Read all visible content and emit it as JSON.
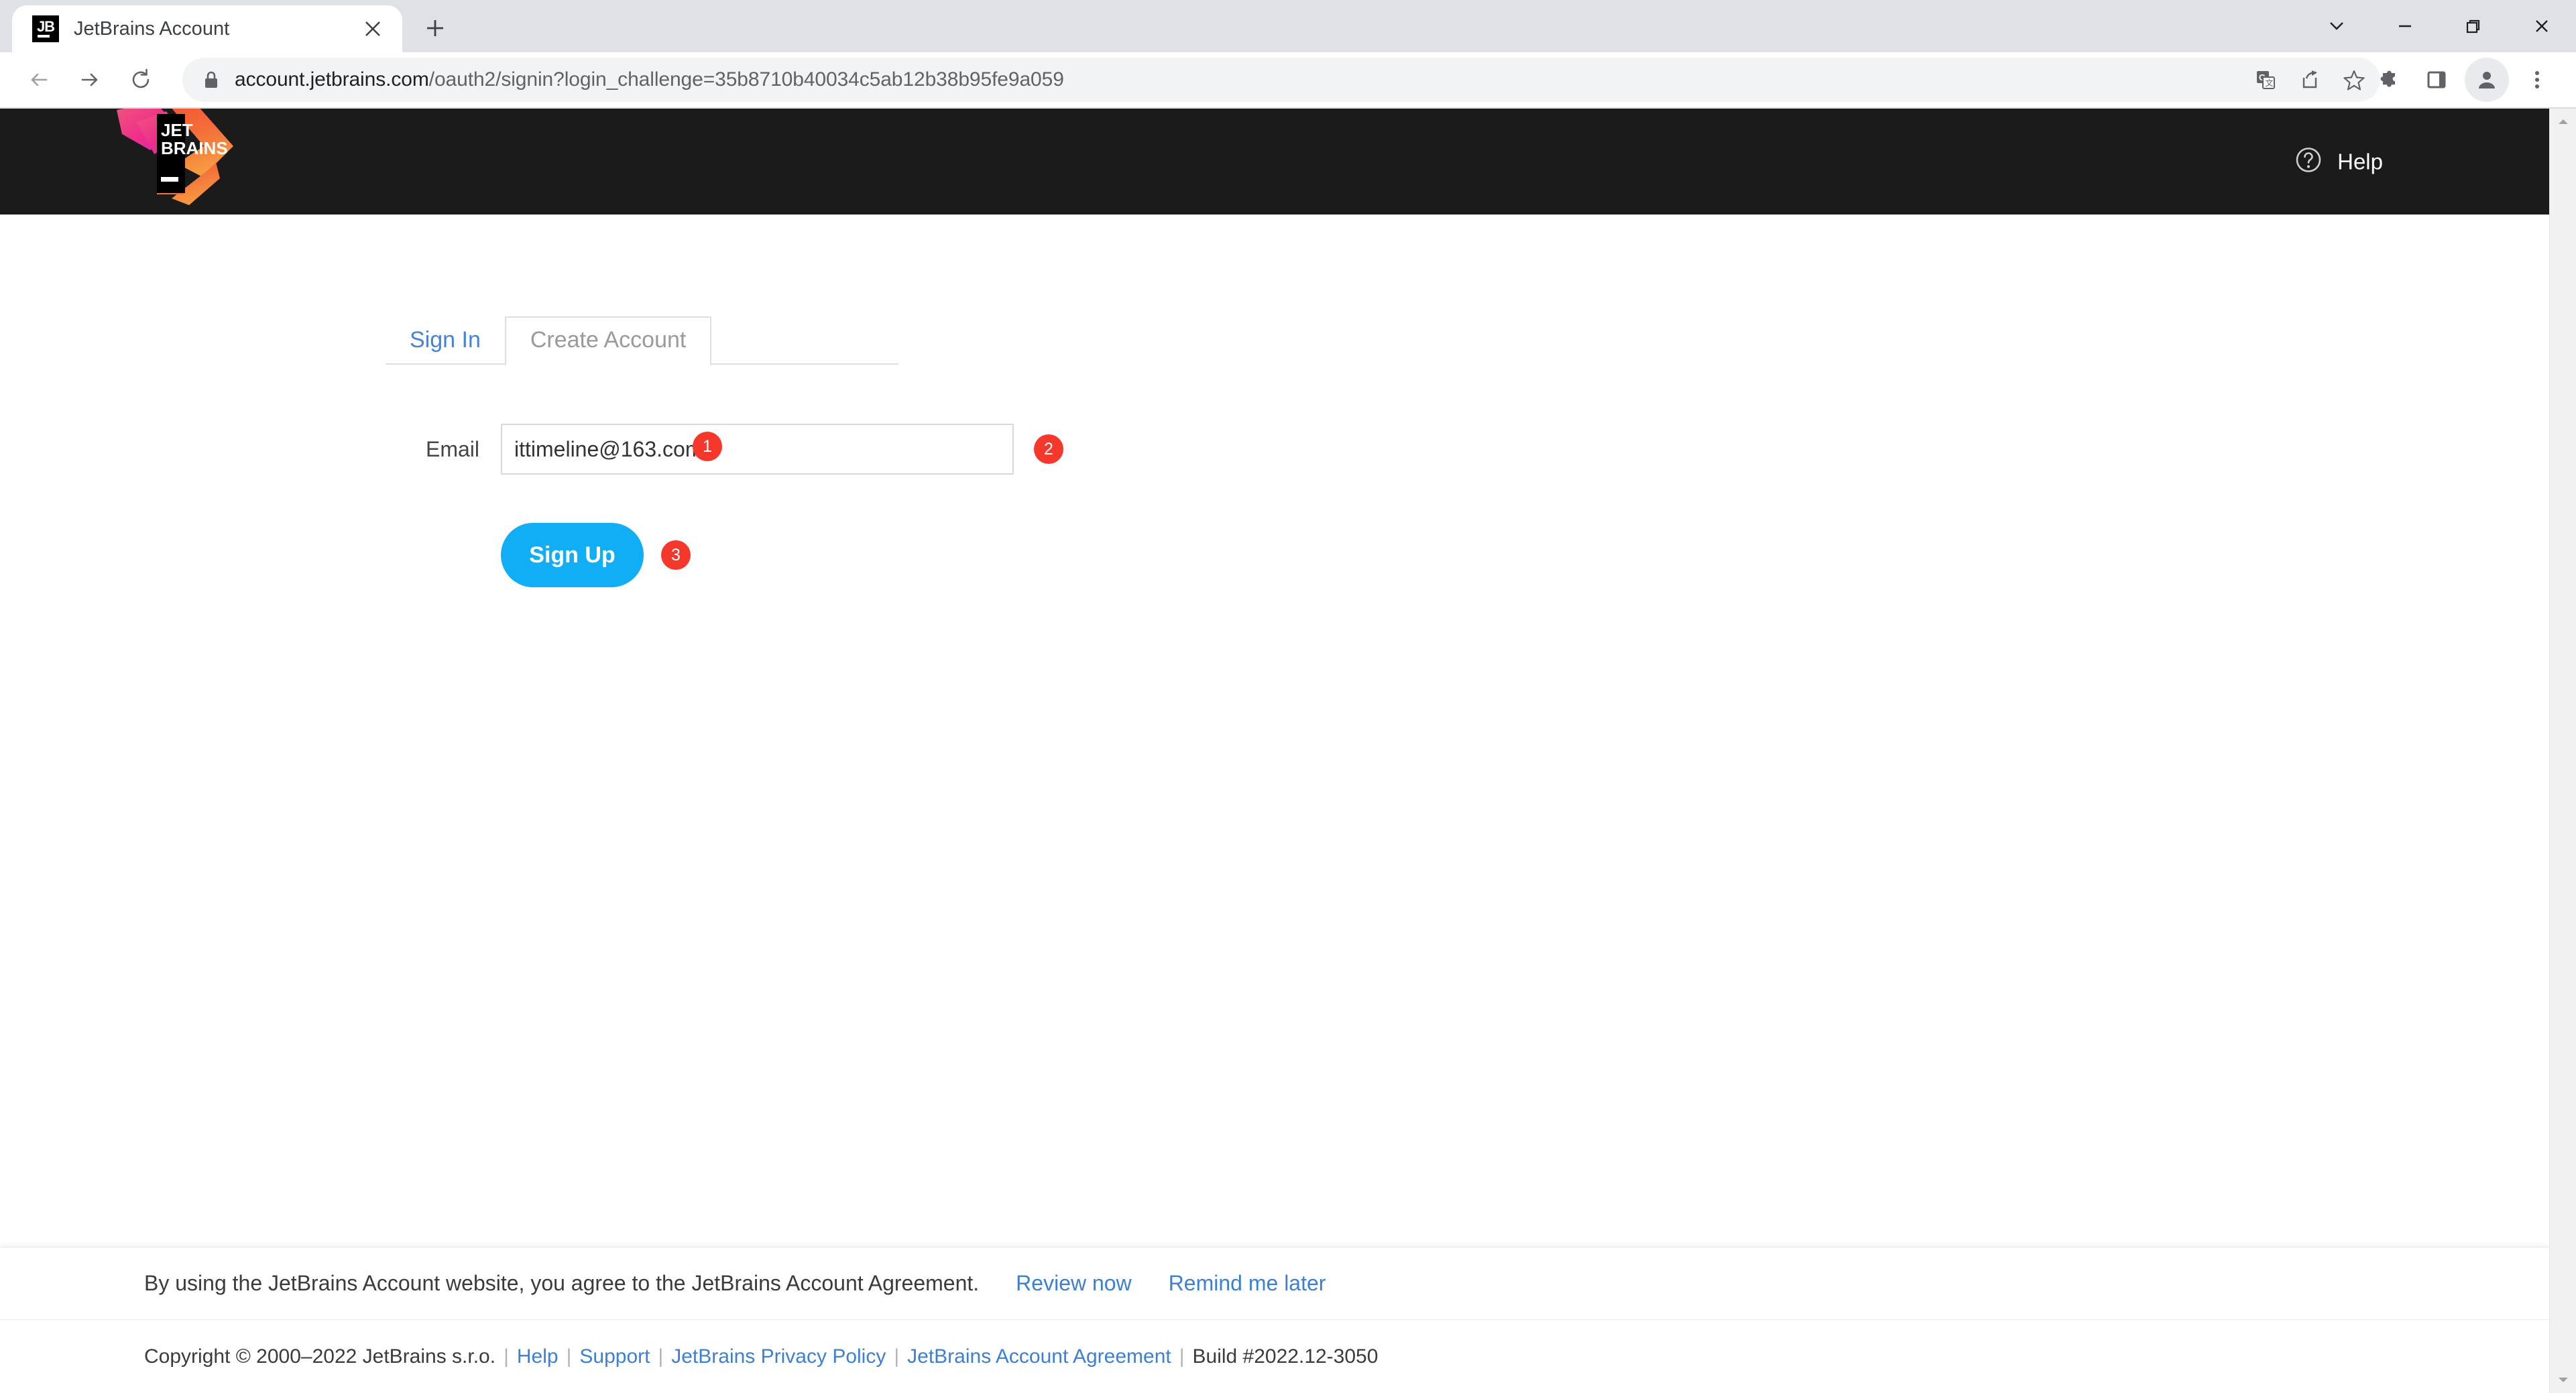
{
  "browser": {
    "tab": {
      "title": "JetBrains Account",
      "favicon_text": "JB",
      "favicon_icon": "jetbrains-favicon",
      "close_icon": "close-icon"
    },
    "new_tab_icon": "plus-icon",
    "window_controls": [
      {
        "name": "tab-search",
        "icon": "chevron-down-icon"
      },
      {
        "name": "minimize",
        "icon": "minimize-icon"
      },
      {
        "name": "restore",
        "icon": "restore-icon"
      },
      {
        "name": "close",
        "icon": "close-icon"
      }
    ],
    "nav": {
      "back_icon": "arrow-left-icon",
      "forward_icon": "arrow-right-icon",
      "reload_icon": "reload-icon"
    },
    "omnibox": {
      "lock_icon": "lock-icon",
      "url_host": "account.jetbrains.com",
      "url_path": "/oauth2/signin?login_challenge=35b8710b40034c5ab12b38b95fe9a059"
    },
    "toolbar_icons": [
      {
        "name": "translate-icon"
      },
      {
        "name": "share-icon"
      },
      {
        "name": "bookmark-star-icon"
      },
      {
        "name": "extensions-puzzle-icon"
      },
      {
        "name": "side-panel-icon"
      },
      {
        "name": "profile-avatar-icon"
      },
      {
        "name": "three-dot-menu-icon"
      }
    ]
  },
  "site": {
    "logo_line1": "JET",
    "logo_line2": "BRAINS",
    "help": {
      "label": "Help",
      "icon": "question-circle-icon"
    }
  },
  "form": {
    "tabs": [
      {
        "label": "Sign In",
        "active": false
      },
      {
        "label": "Create Account",
        "active": true
      }
    ],
    "tabs_badge": "1",
    "email": {
      "label": "Email",
      "value": "ittimeline@163.com",
      "placeholder": "",
      "badge": "2"
    },
    "submit": {
      "label": "Sign Up",
      "badge": "3"
    }
  },
  "agreement": {
    "text": "By using the JetBrains Account website, you agree to the JetBrains Account Agreement.",
    "review_label": "Review now",
    "remind_label": "Remind me later"
  },
  "footer": {
    "copyright": "Copyright © 2000–2022 JetBrains s.r.o.",
    "links": [
      "Help",
      "Support",
      "JetBrains Privacy Policy",
      "JetBrains Account Agreement"
    ],
    "build": "Build #2022.12-3050"
  },
  "colors": {
    "accent_blue": "#11aef6",
    "link_blue": "#3d7fd1",
    "badge_red": "#f6372b",
    "header_dark": "#1b1b1b"
  }
}
